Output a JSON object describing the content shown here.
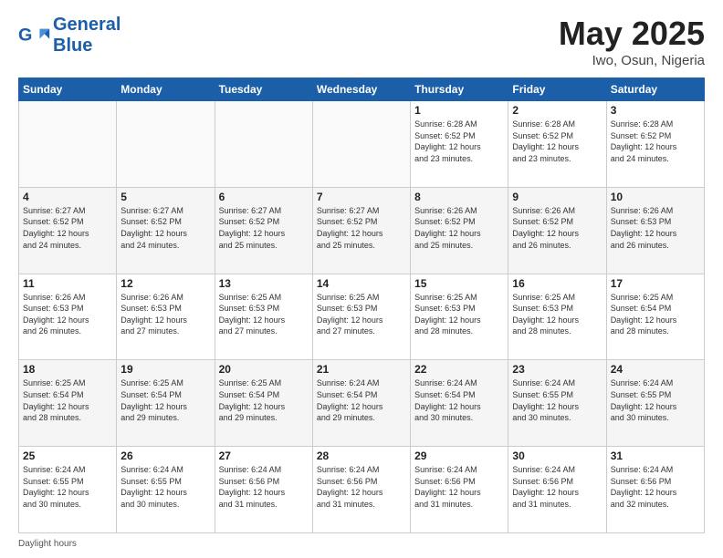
{
  "header": {
    "logo_general": "General",
    "logo_blue": "Blue",
    "title": "May 2025",
    "location": "Iwo, Osun, Nigeria"
  },
  "calendar": {
    "days_of_week": [
      "Sunday",
      "Monday",
      "Tuesday",
      "Wednesday",
      "Thursday",
      "Friday",
      "Saturday"
    ],
    "weeks": [
      [
        {
          "day": "",
          "info": ""
        },
        {
          "day": "",
          "info": ""
        },
        {
          "day": "",
          "info": ""
        },
        {
          "day": "",
          "info": ""
        },
        {
          "day": "1",
          "info": "Sunrise: 6:28 AM\nSunset: 6:52 PM\nDaylight: 12 hours\nand 23 minutes."
        },
        {
          "day": "2",
          "info": "Sunrise: 6:28 AM\nSunset: 6:52 PM\nDaylight: 12 hours\nand 23 minutes."
        },
        {
          "day": "3",
          "info": "Sunrise: 6:28 AM\nSunset: 6:52 PM\nDaylight: 12 hours\nand 24 minutes."
        }
      ],
      [
        {
          "day": "4",
          "info": "Sunrise: 6:27 AM\nSunset: 6:52 PM\nDaylight: 12 hours\nand 24 minutes."
        },
        {
          "day": "5",
          "info": "Sunrise: 6:27 AM\nSunset: 6:52 PM\nDaylight: 12 hours\nand 24 minutes."
        },
        {
          "day": "6",
          "info": "Sunrise: 6:27 AM\nSunset: 6:52 PM\nDaylight: 12 hours\nand 25 minutes."
        },
        {
          "day": "7",
          "info": "Sunrise: 6:27 AM\nSunset: 6:52 PM\nDaylight: 12 hours\nand 25 minutes."
        },
        {
          "day": "8",
          "info": "Sunrise: 6:26 AM\nSunset: 6:52 PM\nDaylight: 12 hours\nand 25 minutes."
        },
        {
          "day": "9",
          "info": "Sunrise: 6:26 AM\nSunset: 6:52 PM\nDaylight: 12 hours\nand 26 minutes."
        },
        {
          "day": "10",
          "info": "Sunrise: 6:26 AM\nSunset: 6:53 PM\nDaylight: 12 hours\nand 26 minutes."
        }
      ],
      [
        {
          "day": "11",
          "info": "Sunrise: 6:26 AM\nSunset: 6:53 PM\nDaylight: 12 hours\nand 26 minutes."
        },
        {
          "day": "12",
          "info": "Sunrise: 6:26 AM\nSunset: 6:53 PM\nDaylight: 12 hours\nand 27 minutes."
        },
        {
          "day": "13",
          "info": "Sunrise: 6:25 AM\nSunset: 6:53 PM\nDaylight: 12 hours\nand 27 minutes."
        },
        {
          "day": "14",
          "info": "Sunrise: 6:25 AM\nSunset: 6:53 PM\nDaylight: 12 hours\nand 27 minutes."
        },
        {
          "day": "15",
          "info": "Sunrise: 6:25 AM\nSunset: 6:53 PM\nDaylight: 12 hours\nand 28 minutes."
        },
        {
          "day": "16",
          "info": "Sunrise: 6:25 AM\nSunset: 6:53 PM\nDaylight: 12 hours\nand 28 minutes."
        },
        {
          "day": "17",
          "info": "Sunrise: 6:25 AM\nSunset: 6:54 PM\nDaylight: 12 hours\nand 28 minutes."
        }
      ],
      [
        {
          "day": "18",
          "info": "Sunrise: 6:25 AM\nSunset: 6:54 PM\nDaylight: 12 hours\nand 28 minutes."
        },
        {
          "day": "19",
          "info": "Sunrise: 6:25 AM\nSunset: 6:54 PM\nDaylight: 12 hours\nand 29 minutes."
        },
        {
          "day": "20",
          "info": "Sunrise: 6:25 AM\nSunset: 6:54 PM\nDaylight: 12 hours\nand 29 minutes."
        },
        {
          "day": "21",
          "info": "Sunrise: 6:24 AM\nSunset: 6:54 PM\nDaylight: 12 hours\nand 29 minutes."
        },
        {
          "day": "22",
          "info": "Sunrise: 6:24 AM\nSunset: 6:54 PM\nDaylight: 12 hours\nand 30 minutes."
        },
        {
          "day": "23",
          "info": "Sunrise: 6:24 AM\nSunset: 6:55 PM\nDaylight: 12 hours\nand 30 minutes."
        },
        {
          "day": "24",
          "info": "Sunrise: 6:24 AM\nSunset: 6:55 PM\nDaylight: 12 hours\nand 30 minutes."
        }
      ],
      [
        {
          "day": "25",
          "info": "Sunrise: 6:24 AM\nSunset: 6:55 PM\nDaylight: 12 hours\nand 30 minutes."
        },
        {
          "day": "26",
          "info": "Sunrise: 6:24 AM\nSunset: 6:55 PM\nDaylight: 12 hours\nand 30 minutes."
        },
        {
          "day": "27",
          "info": "Sunrise: 6:24 AM\nSunset: 6:56 PM\nDaylight: 12 hours\nand 31 minutes."
        },
        {
          "day": "28",
          "info": "Sunrise: 6:24 AM\nSunset: 6:56 PM\nDaylight: 12 hours\nand 31 minutes."
        },
        {
          "day": "29",
          "info": "Sunrise: 6:24 AM\nSunset: 6:56 PM\nDaylight: 12 hours\nand 31 minutes."
        },
        {
          "day": "30",
          "info": "Sunrise: 6:24 AM\nSunset: 6:56 PM\nDaylight: 12 hours\nand 31 minutes."
        },
        {
          "day": "31",
          "info": "Sunrise: 6:24 AM\nSunset: 6:56 PM\nDaylight: 12 hours\nand 32 minutes."
        }
      ]
    ]
  },
  "footer": {
    "text": "Daylight hours"
  }
}
